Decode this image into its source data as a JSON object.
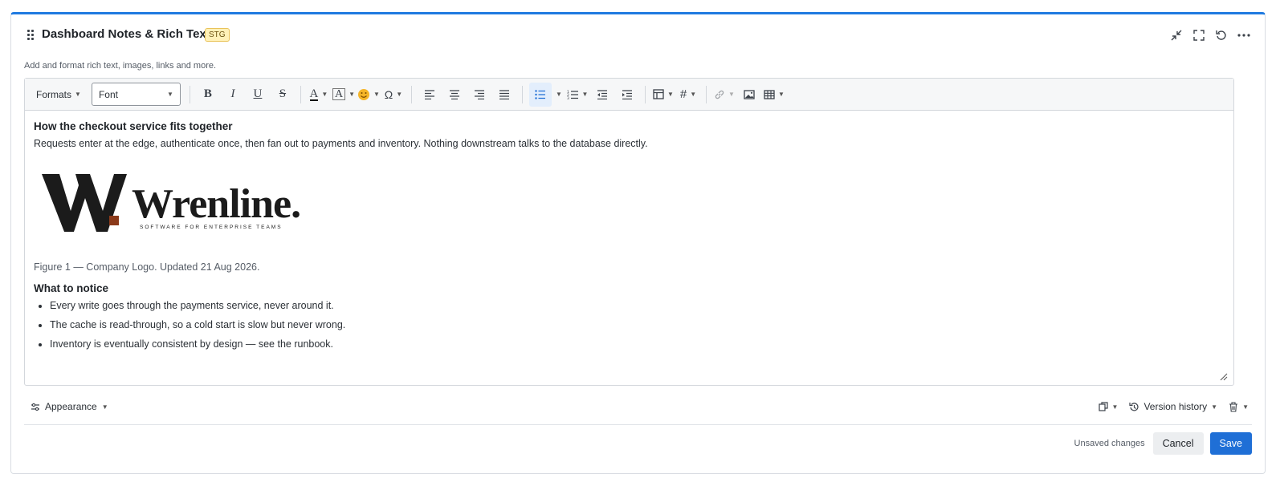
{
  "header": {
    "title": "Dashboard Notes & Rich Text",
    "badge": "STG",
    "subtitle": "Add and format rich text, images, links and more.",
    "actions": [
      "collapse-icon",
      "fullscreen-icon",
      "reset-icon",
      "more-icon"
    ]
  },
  "toolbar": {
    "formats_label": "Formats",
    "font_label": "Font",
    "bold": "B",
    "italic": "I",
    "underline": "U",
    "strike": "S",
    "text_color": "A",
    "bg_color": "A",
    "special_char": "Ω",
    "hash": "#"
  },
  "content": {
    "heading1": "How the checkout service fits together",
    "paragraph1": "Requests enter at the edge, authenticate once, then fan out to payments and inventory. Nothing downstream talks to the database directly.",
    "logo": {
      "text": "Wrenline.",
      "tagline": "SOFTWARE FOR ENTERPRISE TEAMS",
      "accent_color": "#8b3a1a"
    },
    "caption": "Figure 1 — Company Logo. Updated 21 Aug 2026.",
    "heading2": "What to notice",
    "bullets": [
      "Every write goes through the payments service, never around it.",
      "The cache is read-through, so a cold start is slow but never wrong.",
      "Inventory is eventually consistent by design — see the runbook."
    ]
  },
  "footer": {
    "appearance_label": "Appearance",
    "version_history_label": "Version history",
    "unsaved_label": "Unsaved changes",
    "cancel_label": "Cancel",
    "save_label": "Save"
  },
  "colors": {
    "accent": "#1f7ae0",
    "save_button": "#1f6fd6",
    "badge_bg": "#fff1b8"
  }
}
